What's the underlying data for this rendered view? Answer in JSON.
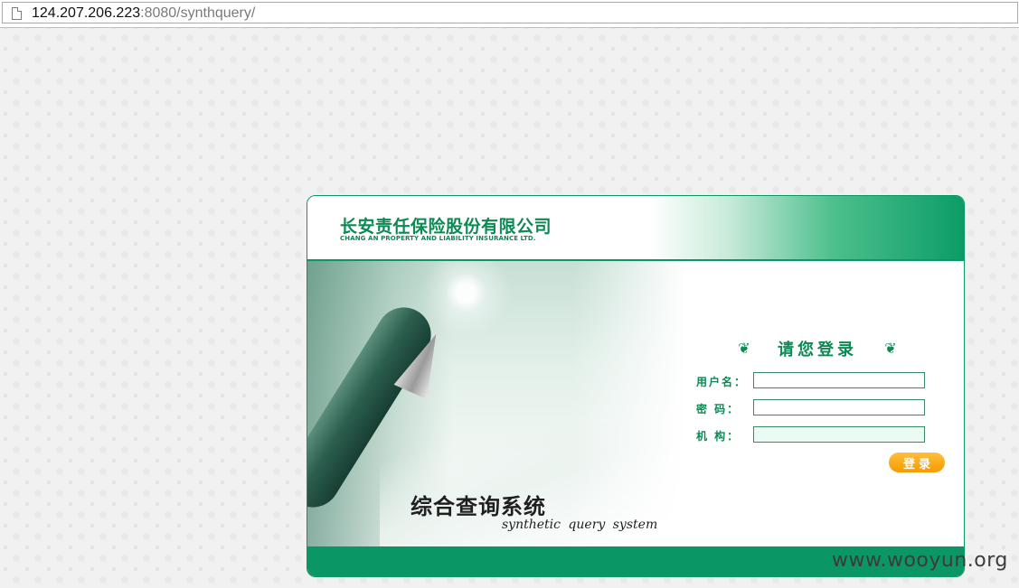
{
  "browser": {
    "url_host": "124.207.206.223",
    "url_rest": ":8080/synthquery/"
  },
  "header": {
    "company_cn": "长安责任保险股份有限公司",
    "company_en": "CHANG AN PROPERTY AND LIABILITY INSURANCE LTD."
  },
  "banner": {
    "system_title_cn": "综合查询系统",
    "system_title_en": "synthetic query system"
  },
  "login": {
    "heading": "请您登录",
    "fields": [
      {
        "label": "用户名：",
        "value": ""
      },
      {
        "label": "密  码：",
        "value": ""
      },
      {
        "label": "机  构：",
        "value": ""
      }
    ],
    "submit_label": "登录"
  },
  "watermark": "www.wooyun.org",
  "colors": {
    "brand_green": "#0b9765",
    "label_green": "#0c8a54",
    "button_orange": "#f59b00"
  }
}
